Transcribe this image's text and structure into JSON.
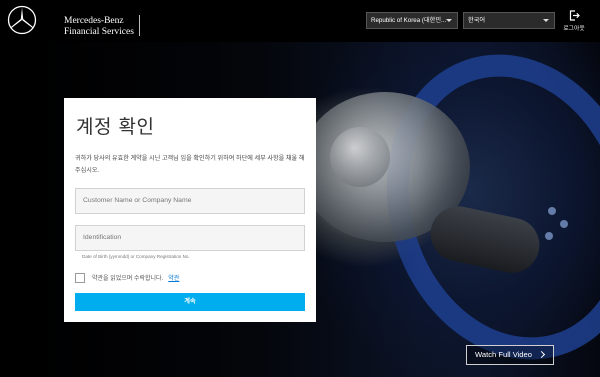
{
  "header": {
    "brand_line1": "Mercedes-Benz",
    "brand_line2": "Financial Services",
    "country_select": "Republic of Korea (대한민...",
    "language_select": "한국어",
    "logout_label": "로그아웃"
  },
  "card": {
    "title": "계정 확인",
    "description": "귀하가 당사의 유효한 계약을 시닌 고객님 임을 확인하기 위하여 하단에 세부 사항을 채울 해 주십시오.",
    "name_placeholder": "Customer Name or Company Name",
    "id_placeholder": "Identification",
    "id_hint": "Date of Birth (yymmdd) or Company Registration No.",
    "terms_label": "약관을 읽었으며 수락합니다.",
    "terms_link": "약관",
    "terms_checked": false,
    "submit_label": "계속"
  },
  "hero": {
    "watch_label": "Watch Full Video"
  },
  "colors": {
    "accent": "#00adef",
    "link": "#0078d6"
  },
  "icons": [
    "mercedes-star-logo",
    "logout-icon",
    "chevron-down-icon",
    "chevron-right-icon"
  ]
}
